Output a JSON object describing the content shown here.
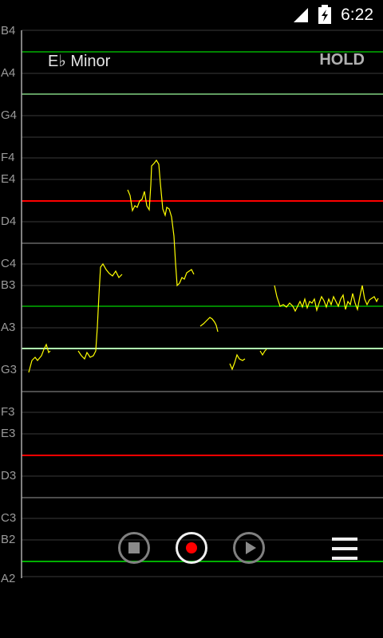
{
  "status_bar": {
    "time": "6:22",
    "signal_icon": "signal-icon",
    "battery_icon": "battery-charging-icon"
  },
  "header": {
    "key": "E♭ Minor",
    "hold": "HOLD"
  },
  "note_labels": [
    "B4",
    "A4",
    "G4",
    "F4",
    "E4",
    "D4",
    "C4",
    "B3",
    "A3",
    "G3",
    "F3",
    "E3",
    "D3",
    "C3",
    "B2",
    "A2"
  ],
  "controls": {
    "stop": "stop-icon",
    "record": "record-icon",
    "play": "play-icon",
    "menu": "menu-icon"
  },
  "colors": {
    "scale_lines": "#00c000",
    "tonic_lines": "#ff0000",
    "pitch_trace": "#ffff00",
    "record_dot": "#ff0000"
  }
}
